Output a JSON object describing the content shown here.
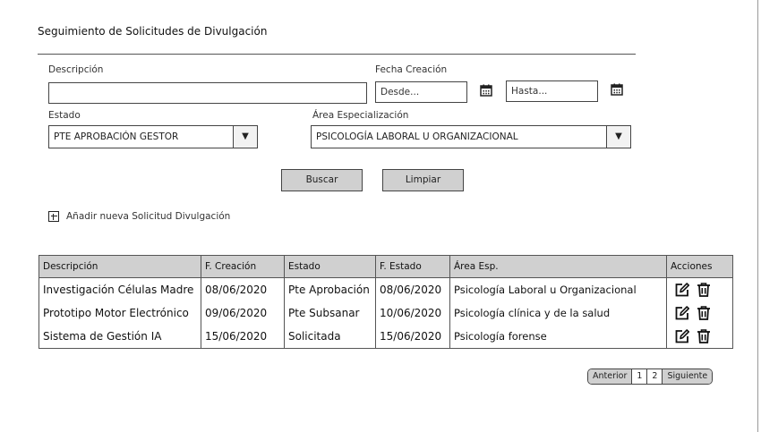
{
  "page": {
    "title": "Seguimiento de Solicitudes de Divulgación"
  },
  "filters": {
    "descripcion_label": "Descripción",
    "descripcion_value": "",
    "fecha_label": "Fecha Creación",
    "desde_placeholder": "Desde...",
    "hasta_placeholder": "Hasta...",
    "estado_label": "Estado",
    "estado_value": "PTE APROBACIÓN GESTOR",
    "area_label": "Área Especialización",
    "area_value": "PSICOLOGÍA LABORAL U ORGANIZACIONAL"
  },
  "actions": {
    "buscar": "Buscar",
    "limpiar": "Limpiar",
    "add_new": "Añadir nueva Solicitud Divulgación"
  },
  "table": {
    "headers": [
      "Descripción",
      "F. Creación",
      "Estado",
      "F. Estado",
      "Área Esp.",
      "Acciones"
    ],
    "rows": [
      [
        "Investigación Células Madre",
        "08/06/2020",
        "Pte Aprobación",
        "08/06/2020",
        "Psicología Laboral u Organizacional"
      ],
      [
        "Prototipo Motor Electrónico",
        "09/06/2020",
        "Pte Subsanar",
        "10/06/2020",
        "Psicología clínica y de la salud"
      ],
      [
        "Sistema de Gestión IA",
        "15/06/2020",
        "Solicitada",
        "15/06/2020",
        "Psicología forense"
      ]
    ]
  },
  "pagination": {
    "prev": "Anterior",
    "pages": [
      "1",
      "2"
    ],
    "next": "Siguiente"
  },
  "icons": {
    "calendar": "calendar-icon",
    "add": "plus-square-icon",
    "edit": "edit-icon",
    "delete": "trash-icon"
  }
}
